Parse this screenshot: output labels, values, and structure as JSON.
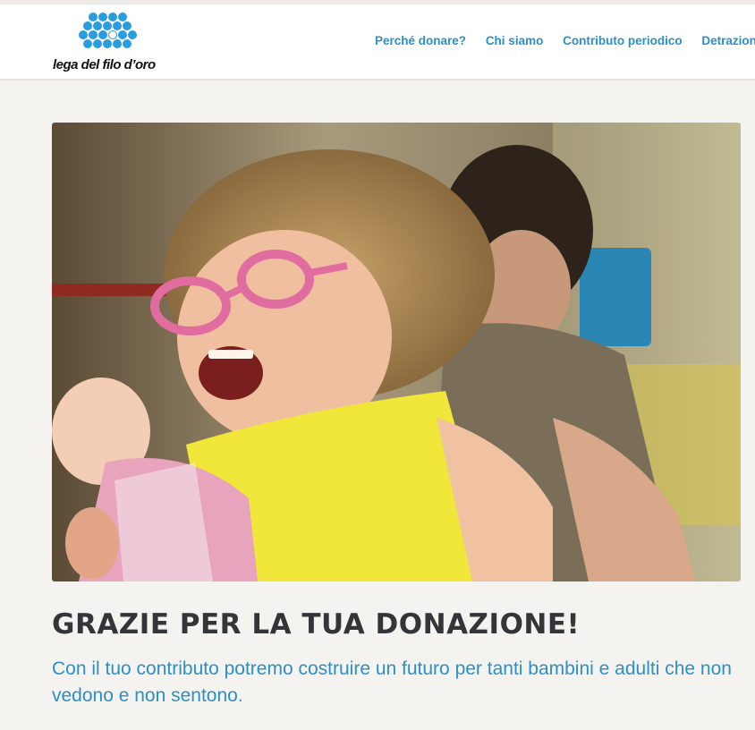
{
  "header": {
    "logo_text": "lega del filo d’oro",
    "nav": [
      {
        "label": "Perché donare?"
      },
      {
        "label": "Chi siamo"
      },
      {
        "label": "Contributo periodico"
      },
      {
        "label": "Detrazione"
      }
    ]
  },
  "hero": {
    "photo_subject": "laughing girl with pink glasses holding a doll, woman behind her"
  },
  "main": {
    "title": "GRAZIE PER LA TUA DONAZIONE!",
    "subtitle": "Con il tuo contributo potremo costruire un futuro per tanti bambini e adulti che non vedono e non sentono."
  },
  "colors": {
    "brand_blue": "#2b8fc8",
    "heading": "#333538",
    "page_bg": "#f5f3ef"
  }
}
